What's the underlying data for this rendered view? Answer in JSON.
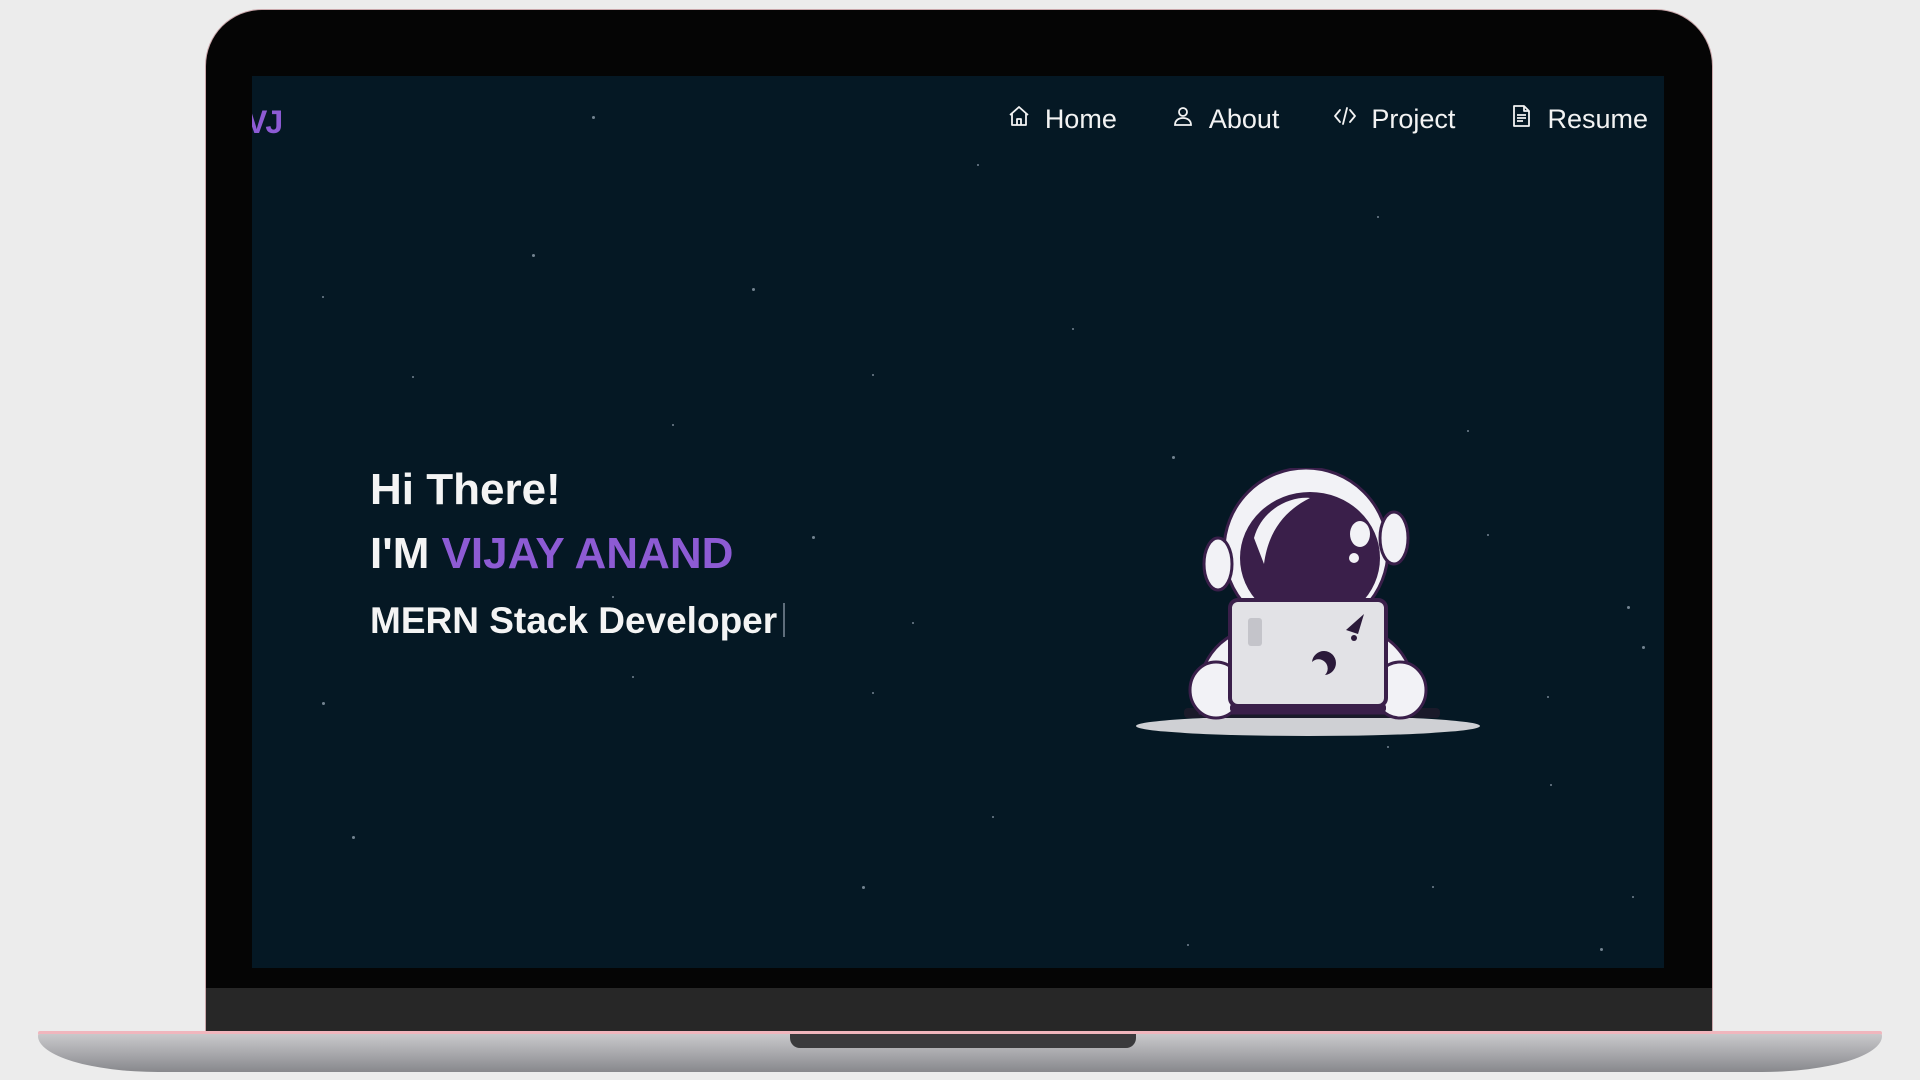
{
  "logo": {
    "text": "VJ"
  },
  "nav": {
    "items": [
      {
        "label": "Home",
        "icon": "home-icon"
      },
      {
        "label": "About",
        "icon": "user-icon"
      },
      {
        "label": "Project",
        "icon": "code-icon"
      },
      {
        "label": "Resume",
        "icon": "document-icon"
      }
    ]
  },
  "hero": {
    "greeting": "Hi There!",
    "intro_prefix": "I'M",
    "name": "VIJAY ANAND",
    "role": "MERN Stack Developer"
  },
  "colors": {
    "accent": "#8d5bd4",
    "background": "#051824",
    "text": "#f3f3f3"
  },
  "illustration": {
    "icon": "astronaut-laptop-illustration"
  }
}
